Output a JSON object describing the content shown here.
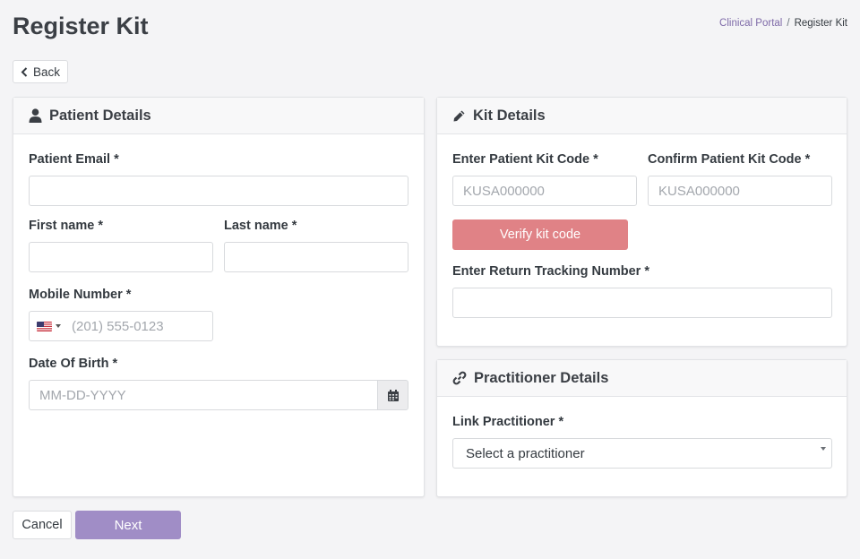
{
  "header": {
    "title": "Register Kit",
    "breadcrumb": {
      "parent": "Clinical Portal",
      "separator": "/",
      "current": "Register Kit"
    }
  },
  "back_label": "Back",
  "patient_card": {
    "title": "Patient Details",
    "email_label": "Patient Email *",
    "email_value": "",
    "first_name_label": "First name *",
    "last_name_label": "Last name *",
    "mobile_label": "Mobile Number *",
    "mobile_placeholder": "(201) 555-0123",
    "dob_label": "Date Of Birth *",
    "dob_placeholder": "MM-DD-YYYY"
  },
  "kit_card": {
    "title": "Kit Details",
    "kit_code_label": "Enter Patient Kit Code *",
    "kit_code_placeholder": "KUSA000000",
    "confirm_kit_code_label": "Confirm Patient Kit Code *",
    "confirm_kit_code_placeholder": "KUSA000000",
    "verify_label": "Verify kit code",
    "tracking_label": "Enter Return Tracking Number *"
  },
  "practitioner_card": {
    "title": "Practitioner Details",
    "link_label": "Link Practitioner *",
    "select_value": "Select a practitioner"
  },
  "footer": {
    "cancel_label": "Cancel",
    "next_label": "Next"
  },
  "icons": {
    "back": "chevron-left-icon",
    "patient": "user-icon",
    "kit": "pen-icon",
    "practitioner": "link-icon",
    "calendar": "calendar-icon",
    "flag": "us-flag-icon"
  },
  "colors": {
    "accent": "#a08dc6",
    "verify_button": "#e08286",
    "breadcrumb_link": "#7e6aa8"
  }
}
